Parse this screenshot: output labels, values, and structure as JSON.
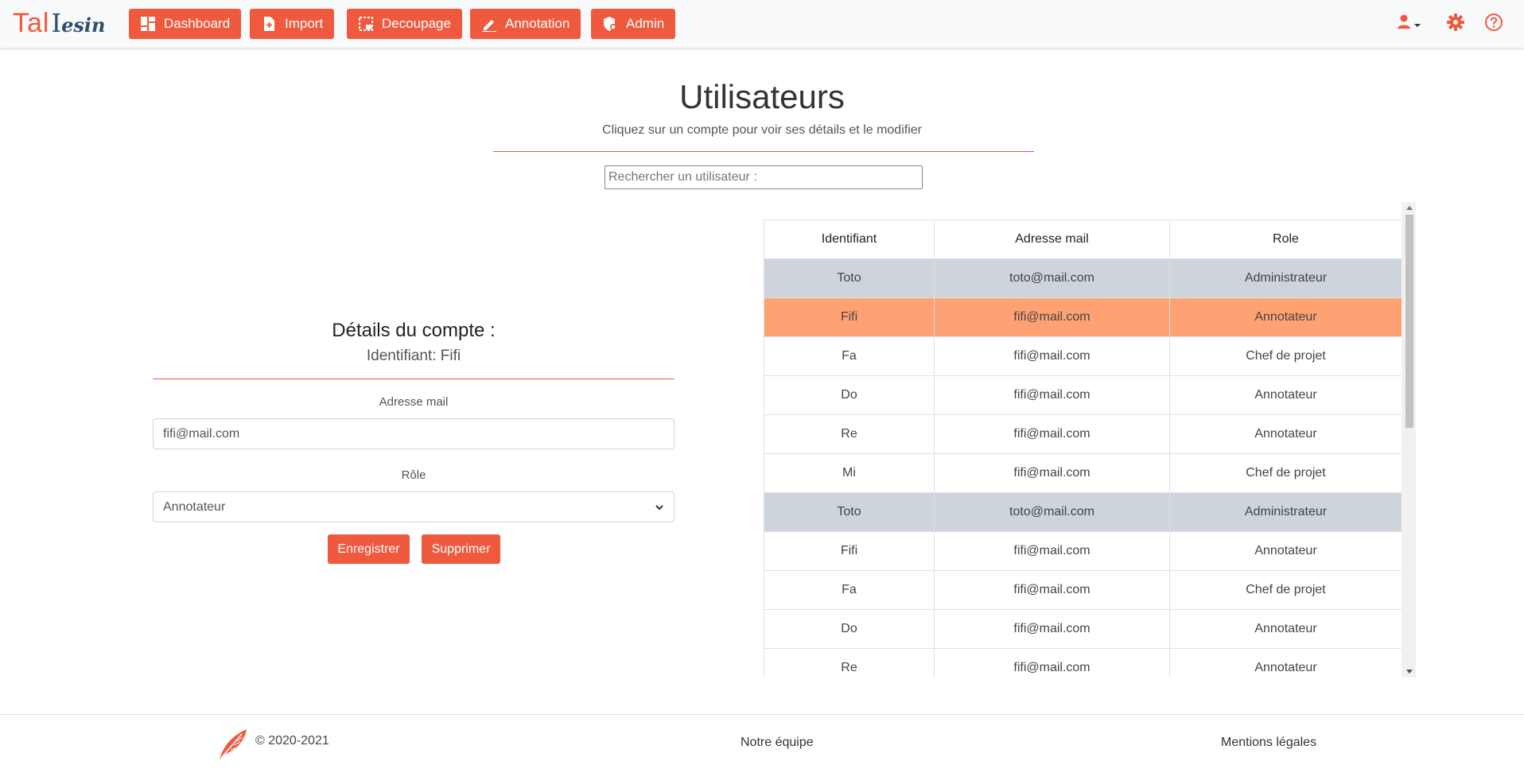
{
  "brand": {
    "part1": "Tal",
    "part2": "I",
    "part3": "esin"
  },
  "nav": {
    "items": [
      {
        "label": "Dashboard"
      },
      {
        "label": "Import"
      },
      {
        "label": "Decoupage"
      },
      {
        "label": "Annotation"
      },
      {
        "label": "Admin"
      }
    ]
  },
  "header_icons": [
    "user-icon",
    "gear-icon",
    "help-icon"
  ],
  "colors": {
    "accent": "#ef5a3e",
    "selected_row": "#ffa273",
    "admin_row": "#cdd4dc",
    "logo_dark": "#2c4f6e"
  },
  "page": {
    "title": "Utilisateurs",
    "subtitle": "Cliquez sur un compte pour voir ses détails et le modifier",
    "search_placeholder": "Rechercher un utilisateur :"
  },
  "details": {
    "title": "Détails du compte :",
    "identifier": "Identifiant: Fifi",
    "email_label": "Adresse mail",
    "email_value": "fifi@mail.com",
    "role_label": "Rôle",
    "role_value": "Annotateur",
    "save_label": "Enregistrer",
    "delete_label": "Supprimer"
  },
  "table": {
    "headers": [
      "Identifiant",
      "Adresse mail",
      "Role"
    ],
    "rows": [
      {
        "id": "Toto",
        "email": "toto@mail.com",
        "role": "Administrateur"
      },
      {
        "id": "Fifi",
        "email": "fifi@mail.com",
        "role": "Annotateur"
      },
      {
        "id": "Fa",
        "email": "fifi@mail.com",
        "role": "Chef de projet"
      },
      {
        "id": "Do",
        "email": "fifi@mail.com",
        "role": "Annotateur"
      },
      {
        "id": "Re",
        "email": "fifi@mail.com",
        "role": "Annotateur"
      },
      {
        "id": "Mi",
        "email": "fifi@mail.com",
        "role": "Chef de projet"
      },
      {
        "id": "Toto",
        "email": "toto@mail.com",
        "role": "Administrateur"
      },
      {
        "id": "Fifi",
        "email": "fifi@mail.com",
        "role": "Annotateur"
      },
      {
        "id": "Fa",
        "email": "fifi@mail.com",
        "role": "Chef de projet"
      },
      {
        "id": "Do",
        "email": "fifi@mail.com",
        "role": "Annotateur"
      },
      {
        "id": "Re",
        "email": "fifi@mail.com",
        "role": "Annotateur"
      }
    ],
    "selected_index": 1
  },
  "footer": {
    "copyright": "© 2020-2021",
    "team_link": "Notre équipe",
    "legal_link": "Mentions légales"
  }
}
